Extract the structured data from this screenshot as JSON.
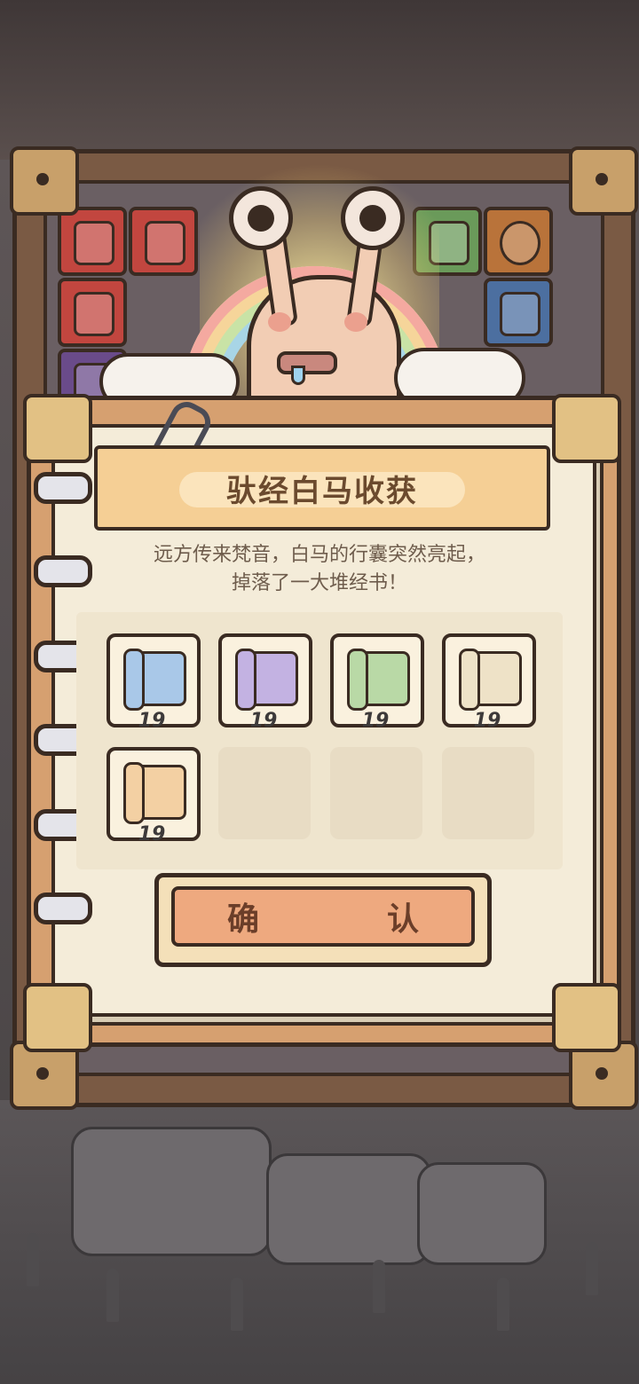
{
  "dialog": {
    "title": "驮经白马收获",
    "description_line1": "远方传来梵音，白马的行囊突然亮起，",
    "description_line2": "掉落了一大堆经书！",
    "confirm_label": "确　认"
  },
  "rewards": [
    {
      "icon": "blue-scripture-scroll-icon",
      "count": "19",
      "color": "#a9c8e8"
    },
    {
      "icon": "purple-scripture-scroll-icon",
      "count": "19",
      "color": "#c3b2e2"
    },
    {
      "icon": "green-scripture-scroll-icon",
      "count": "19",
      "color": "#b9d9a6"
    },
    {
      "icon": "cream-scripture-scroll-icon",
      "count": "19",
      "color": "#eee2c7"
    },
    {
      "icon": "lotus-scripture-scroll-icon",
      "count": "19",
      "color": "#f3d0a3"
    }
  ],
  "background_tiles": [
    {
      "icon": "battery-tile-icon",
      "color": "#c2463f"
    },
    {
      "icon": "battery-tile-icon",
      "color": "#c2463f"
    },
    {
      "icon": "potion-tile-icon",
      "color": "#6a9a5a"
    },
    {
      "icon": "potion-tile-icon",
      "color": "#6a9a5a"
    },
    {
      "icon": "star-badge-tile-icon",
      "color": "#b9733a"
    },
    {
      "icon": "battery-tile-icon",
      "color": "#c2463f"
    },
    {
      "icon": "potion-tile-icon",
      "color": "#4c6fa0"
    },
    {
      "icon": "figure-tile-icon",
      "color": "#6a4b8a"
    }
  ]
}
